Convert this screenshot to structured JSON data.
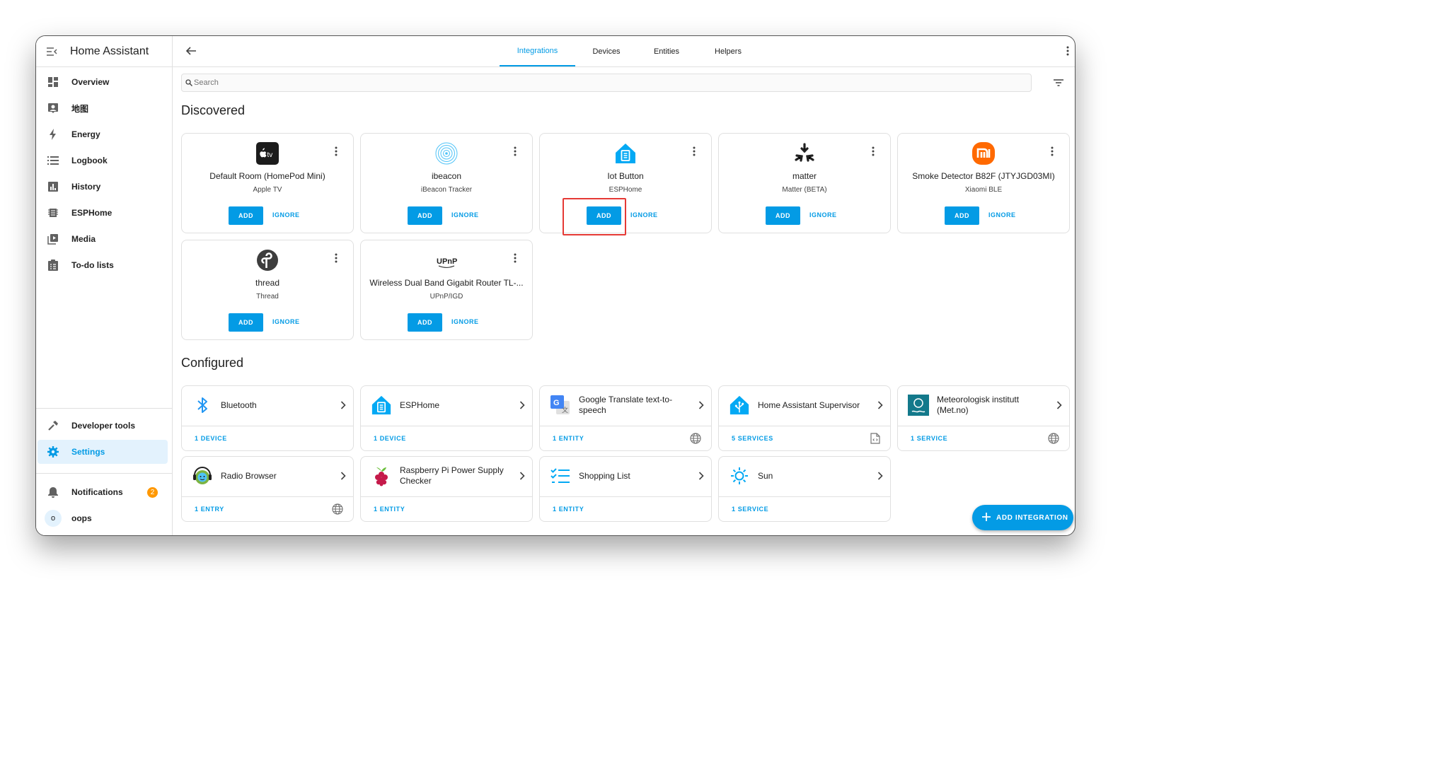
{
  "app": {
    "title": "Home Assistant"
  },
  "sidebar": {
    "items": [
      {
        "label": "Overview",
        "icon": "dashboard-icon"
      },
      {
        "label": "地图",
        "icon": "map-account-icon"
      },
      {
        "label": "Energy",
        "icon": "lightning-icon"
      },
      {
        "label": "Logbook",
        "icon": "list-icon"
      },
      {
        "label": "History",
        "icon": "chart-box-icon"
      },
      {
        "label": "ESPHome",
        "icon": "chip-icon"
      },
      {
        "label": "Media",
        "icon": "play-box-icon"
      },
      {
        "label": "To-do lists",
        "icon": "clipboard-list-icon"
      }
    ],
    "developer_tools": "Developer tools",
    "settings": "Settings",
    "notifications": "Notifications",
    "notifications_count": "2",
    "user": "oops",
    "user_initial": "o"
  },
  "tabs": [
    {
      "label": "Integrations",
      "active": true
    },
    {
      "label": "Devices",
      "active": false
    },
    {
      "label": "Entities",
      "active": false
    },
    {
      "label": "Helpers",
      "active": false
    }
  ],
  "search": {
    "placeholder": "Search"
  },
  "discovered": {
    "title": "Discovered",
    "add_label": "ADD",
    "ignore_label": "IGNORE",
    "cards": [
      {
        "name": "Default Room (HomePod Mini)",
        "sub": "Apple TV",
        "icon": "apple-tv-icon"
      },
      {
        "name": "ibeacon",
        "sub": "iBeacon Tracker",
        "icon": "ibeacon-icon"
      },
      {
        "name": "Iot Button",
        "sub": "ESPHome",
        "icon": "esphome-icon"
      },
      {
        "name": "matter",
        "sub": "Matter (BETA)",
        "icon": "matter-icon"
      },
      {
        "name": "Smoke Detector B82F (JTYJGD03MI)",
        "sub": "Xiaomi BLE",
        "icon": "xiaomi-icon"
      },
      {
        "name": "thread",
        "sub": "Thread",
        "icon": "thread-icon"
      },
      {
        "name": "Wireless Dual Band Gigabit Router TL-...",
        "sub": "UPnP/IGD",
        "icon": "upnp-icon"
      }
    ]
  },
  "configured": {
    "title": "Configured",
    "cards": [
      {
        "name": "Bluetooth",
        "footer": "1 DEVICE",
        "icon": "bluetooth-icon",
        "right_icon": ""
      },
      {
        "name": "ESPHome",
        "footer": "1 DEVICE",
        "icon": "esphome-icon",
        "right_icon": ""
      },
      {
        "name": "Google Translate text-to-speech",
        "footer": "1 ENTITY",
        "icon": "google-translate-icon",
        "right_icon": "web-icon"
      },
      {
        "name": "Home Assistant Supervisor",
        "footer": "5 SERVICES",
        "icon": "home-assistant-icon",
        "right_icon": "file-code-icon"
      },
      {
        "name": "Meteorologisk institutt (Met.no)",
        "footer": "1 SERVICE",
        "icon": "met-no-icon",
        "right_icon": "web-icon"
      },
      {
        "name": "Radio Browser",
        "footer": "1 ENTRY",
        "icon": "radio-browser-icon",
        "right_icon": "web-icon"
      },
      {
        "name": "Raspberry Pi Power Supply Checker",
        "footer": "1 ENTITY",
        "icon": "raspberry-pi-icon",
        "right_icon": ""
      },
      {
        "name": "Shopping List",
        "footer": "1 ENTITY",
        "icon": "shopping-list-icon",
        "right_icon": ""
      },
      {
        "name": "Sun",
        "footer": "1 SERVICE",
        "icon": "sun-icon",
        "right_icon": ""
      }
    ]
  },
  "fab": {
    "label": "ADD INTEGRATION"
  },
  "colors": {
    "accent": "#039be5",
    "highlight": "#e53935",
    "badge": "#ff9800"
  }
}
